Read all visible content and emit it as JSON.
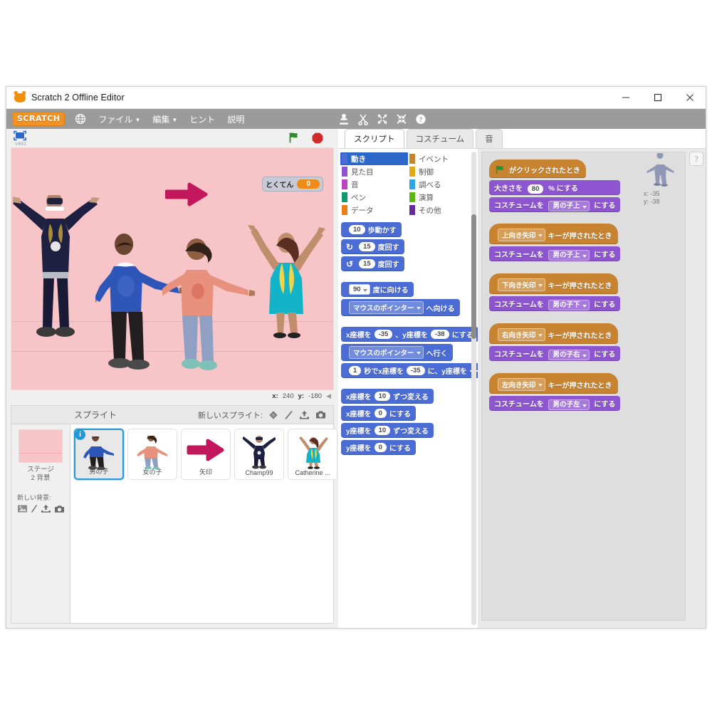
{
  "window": {
    "title": "Scratch 2 Offline Editor",
    "minimize_label": "minimize",
    "maximize_label": "maximize",
    "close_label": "close"
  },
  "menubar": {
    "logo": "SCRATCH",
    "globe_icon": "globe-icon",
    "items": [
      {
        "label": "ファイル",
        "has_caret": true
      },
      {
        "label": "編集",
        "has_caret": true
      },
      {
        "label": "ヒント",
        "has_caret": false
      },
      {
        "label": "説明",
        "has_caret": false
      }
    ],
    "tools": [
      {
        "name": "stamp-icon"
      },
      {
        "name": "scissors-icon"
      },
      {
        "name": "grow-icon"
      },
      {
        "name": "shrink-icon"
      },
      {
        "name": "help-icon"
      }
    ]
  },
  "stage": {
    "fullscreen_icon": "fullscreen-icon",
    "version": "v461",
    "green_flag_icon": "green-flag-icon",
    "stop_icon": "stop-icon",
    "background_color": "#f7c4c7",
    "variable": {
      "name": "とくてん",
      "value": "0"
    },
    "coords": {
      "x_label": "x:",
      "x_value": "240",
      "y_label": "y:",
      "y_value": "-180"
    },
    "collapse_icon": "collapse-arrow-icon"
  },
  "sprite_pane": {
    "title": "スプライト",
    "new_sprite_label": "新しいスプライト:",
    "new_sprite_icons": [
      "library-icon",
      "paint-icon",
      "upload-icon",
      "camera-icon"
    ],
    "stage_label_line1": "ステージ",
    "stage_label_line2": "2 背景",
    "new_backdrop_label": "新しい背景:",
    "new_backdrop_icons": [
      "library-icon",
      "paint-icon",
      "upload-icon",
      "camera-icon"
    ],
    "sprites": [
      {
        "name": "男の子",
        "selected": true,
        "info_badge": "i"
      },
      {
        "name": "女の子",
        "selected": false
      },
      {
        "name": "矢印",
        "selected": false
      },
      {
        "name": "Champ99",
        "selected": false
      },
      {
        "name": "Catherine ...",
        "selected": false
      }
    ]
  },
  "tabs": [
    {
      "label": "スクリプト",
      "active": true
    },
    {
      "label": "コスチューム",
      "active": false
    },
    {
      "label": "音",
      "active": false
    }
  ],
  "palette": {
    "categories_left": [
      {
        "label": "動き",
        "color": "#4a6cd4",
        "selected": true
      },
      {
        "label": "見た目",
        "color": "#8e55d0",
        "selected": false
      },
      {
        "label": "音",
        "color": "#bb42c3",
        "selected": false
      },
      {
        "label": "ペン",
        "color": "#0e9a6c",
        "selected": false
      },
      {
        "label": "データ",
        "color": "#ee7d16",
        "selected": false
      }
    ],
    "categories_right": [
      {
        "label": "イベント",
        "color": "#c88330",
        "selected": false
      },
      {
        "label": "制御",
        "color": "#e1a91a",
        "selected": false
      },
      {
        "label": "調べる",
        "color": "#2ca5e2",
        "selected": false
      },
      {
        "label": "演算",
        "color": "#5cb712",
        "selected": false
      },
      {
        "label": "その他",
        "color": "#632d99",
        "selected": false
      }
    ],
    "blocks": [
      {
        "id": "move",
        "parts": [
          {
            "t": "num",
            "v": "10"
          },
          {
            "t": "lbl",
            "v": "歩動かす"
          }
        ]
      },
      {
        "id": "turn_cw",
        "parts": [
          {
            "t": "ico",
            "v": "↻"
          },
          {
            "t": "num",
            "v": "15"
          },
          {
            "t": "lbl",
            "v": "度回す"
          }
        ]
      },
      {
        "id": "turn_ccw",
        "parts": [
          {
            "t": "ico",
            "v": "↺"
          },
          {
            "t": "num",
            "v": "15"
          },
          {
            "t": "lbl",
            "v": "度回す"
          }
        ]
      },
      {
        "id": "point_dir",
        "parts": [
          {
            "t": "dropl",
            "v": "90"
          },
          {
            "t": "lbl",
            "v": "度に向ける"
          }
        ]
      },
      {
        "id": "point_to",
        "parts": [
          {
            "t": "drop",
            "v": "マウスのポインター"
          },
          {
            "t": "lbl",
            "v": "へ向ける"
          }
        ]
      },
      {
        "id": "goto_xy",
        "parts": [
          {
            "t": "lbl",
            "v": "x座標を"
          },
          {
            "t": "num",
            "v": "-35"
          },
          {
            "t": "lbl",
            "v": "、y座標を"
          },
          {
            "t": "num",
            "v": "-38"
          },
          {
            "t": "lbl",
            "v": "にする"
          }
        ]
      },
      {
        "id": "goto",
        "parts": [
          {
            "t": "drop",
            "v": "マウスのポインター"
          },
          {
            "t": "lbl",
            "v": "へ行く"
          }
        ]
      },
      {
        "id": "glide",
        "parts": [
          {
            "t": "num",
            "v": "1"
          },
          {
            "t": "lbl",
            "v": "秒でx座標を"
          },
          {
            "t": "num",
            "v": "-35"
          },
          {
            "t": "lbl",
            "v": "に、y座標を"
          },
          {
            "t": "num",
            "v": ""
          }
        ]
      },
      {
        "id": "change_x",
        "parts": [
          {
            "t": "lbl",
            "v": "x座標を"
          },
          {
            "t": "num",
            "v": "10"
          },
          {
            "t": "lbl",
            "v": "ずつ変える"
          }
        ]
      },
      {
        "id": "set_x",
        "parts": [
          {
            "t": "lbl",
            "v": "x座標を"
          },
          {
            "t": "num",
            "v": "0"
          },
          {
            "t": "lbl",
            "v": "にする"
          }
        ]
      },
      {
        "id": "change_y",
        "parts": [
          {
            "t": "lbl",
            "v": "y座標を"
          },
          {
            "t": "num",
            "v": "10"
          },
          {
            "t": "lbl",
            "v": "ずつ変える"
          }
        ]
      },
      {
        "id": "set_y",
        "parts": [
          {
            "t": "lbl",
            "v": "y座標を"
          },
          {
            "t": "num",
            "v": "0"
          },
          {
            "t": "lbl",
            "v": "にする"
          }
        ]
      }
    ]
  },
  "scripts": {
    "sprite_info": {
      "x_label": "x:",
      "x_value": "-35",
      "y_label": "y:",
      "y_value": "-38"
    },
    "help_button": "?",
    "stacks": [
      {
        "hat": {
          "type": "events",
          "icon": "green-flag-icon",
          "text": "がクリックされたとき"
        },
        "blocks": [
          {
            "type": "looks",
            "parts": [
              {
                "t": "lbl",
                "v": "大きさを"
              },
              {
                "t": "num",
                "v": "80"
              },
              {
                "t": "lbl",
                "v": "% にする"
              }
            ]
          },
          {
            "type": "looks",
            "parts": [
              {
                "t": "lbl",
                "v": "コスチュームを"
              },
              {
                "t": "drop",
                "v": "男の子上"
              },
              {
                "t": "lbl",
                "v": "にする"
              }
            ]
          }
        ]
      },
      {
        "hat": {
          "type": "events",
          "dropdown": "上向き矢印",
          "text": "キーが押されたとき"
        },
        "blocks": [
          {
            "type": "looks",
            "parts": [
              {
                "t": "lbl",
                "v": "コスチュームを"
              },
              {
                "t": "drop",
                "v": "男の子上"
              },
              {
                "t": "lbl",
                "v": "にする"
              }
            ]
          }
        ]
      },
      {
        "hat": {
          "type": "events",
          "dropdown": "下向き矢印",
          "text": "キーが押されたとき"
        },
        "blocks": [
          {
            "type": "looks",
            "parts": [
              {
                "t": "lbl",
                "v": "コスチュームを"
              },
              {
                "t": "drop",
                "v": "男の子下"
              },
              {
                "t": "lbl",
                "v": "にする"
              }
            ]
          }
        ]
      },
      {
        "hat": {
          "type": "events",
          "dropdown": "右向き矢印",
          "text": "キーが押されたとき"
        },
        "blocks": [
          {
            "type": "looks",
            "parts": [
              {
                "t": "lbl",
                "v": "コスチュームを"
              },
              {
                "t": "drop",
                "v": "男の子右"
              },
              {
                "t": "lbl",
                "v": "にする"
              }
            ]
          }
        ]
      },
      {
        "hat": {
          "type": "events",
          "dropdown": "左向き矢印",
          "text": "キーが押されたとき"
        },
        "blocks": [
          {
            "type": "looks",
            "parts": [
              {
                "t": "lbl",
                "v": "コスチュームを"
              },
              {
                "t": "drop",
                "v": "男の子左"
              },
              {
                "t": "lbl",
                "v": "にする"
              }
            ]
          }
        ]
      }
    ]
  },
  "colors": {
    "motion": "#4a6cd4",
    "looks": "#8e55d0",
    "events": "#c88330",
    "accent_blue": "#2b66c9",
    "stage_pink": "#f7c4c7",
    "arrow_magenta": "#c2185b",
    "menubar_gray": "#9b9b9b"
  }
}
